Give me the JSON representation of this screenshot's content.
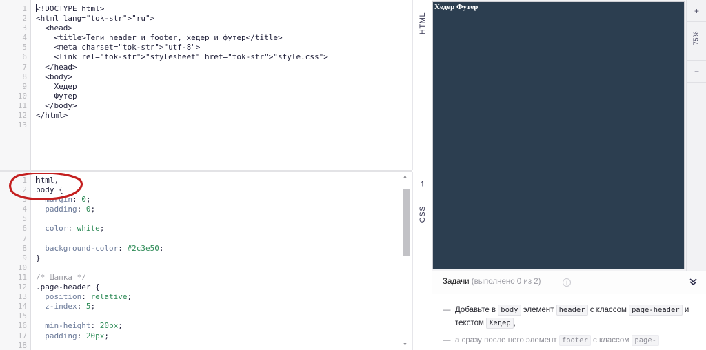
{
  "editors": {
    "html": {
      "lang_label": "HTML",
      "line_numbers": [
        "1",
        "2",
        "3",
        "4",
        "5",
        "6",
        "7",
        "8",
        "9",
        "10",
        "11",
        "12",
        "13"
      ],
      "lines": [
        "<!DOCTYPE html>",
        "<html lang=\"ru\">",
        "  <head>",
        "    <title>Теги header и footer, хедер и футер</title>",
        "    <meta charset=\"utf-8\">",
        "    <link rel=\"stylesheet\" href=\"style.css\">",
        "  </head>",
        "  <body>",
        "    Хедер",
        "    Футер",
        "  </body>",
        "</html>",
        ""
      ]
    },
    "css": {
      "lang_label": "CSS",
      "up_arrow": "↑",
      "line_numbers": [
        "1",
        "2",
        "3",
        "4",
        "5",
        "6",
        "7",
        "8",
        "9",
        "10",
        "11",
        "12",
        "13",
        "14",
        "15",
        "16",
        "17",
        "18"
      ],
      "lines": [
        "html,",
        "body {",
        "  margin: 0;",
        "  padding: 0;",
        "",
        "  color: white;",
        "",
        "  background-color: #2c3e50;",
        "}",
        "",
        "/* Шапка */",
        ".page-header {",
        "  position: relative;",
        "  z-index: 5;",
        "",
        "  min-height: 20px;",
        "  padding: 20px;",
        ""
      ]
    }
  },
  "preview": {
    "text": "Хедер Футер",
    "background_color": "#2c3e50",
    "text_color": "#ffffff"
  },
  "zoom_rail": {
    "zoom_in_label": "+",
    "zoom_level": "75%",
    "zoom_out_label": "−"
  },
  "tasks": {
    "title": "Задачи",
    "progress": "(выполнено 0 из 2)",
    "info_icon": "i",
    "collapse_icon": "chevron-double-down",
    "items": [
      {
        "parts": [
          {
            "t": "text",
            "v": "Добавьте в "
          },
          {
            "t": "code",
            "v": "body"
          },
          {
            "t": "text",
            "v": " элемент "
          },
          {
            "t": "code",
            "v": "header"
          },
          {
            "t": "text",
            "v": " с классом "
          },
          {
            "t": "code",
            "v": "page-header"
          },
          {
            "t": "text",
            "v": " и текстом "
          },
          {
            "t": "code",
            "v": "Хедер"
          },
          {
            "t": "text",
            "v": ","
          }
        ]
      },
      {
        "parts": [
          {
            "t": "text",
            "v": "а сразу после него элемент "
          },
          {
            "t": "code",
            "v": "footer"
          },
          {
            "t": "text",
            "v": " с классом "
          },
          {
            "t": "code",
            "v": "page-"
          }
        ]
      }
    ],
    "bullet": "—"
  },
  "annotation": {
    "type": "hand-drawn-red-ellipse",
    "color": "#c41f1f",
    "target": "html, body {"
  }
}
